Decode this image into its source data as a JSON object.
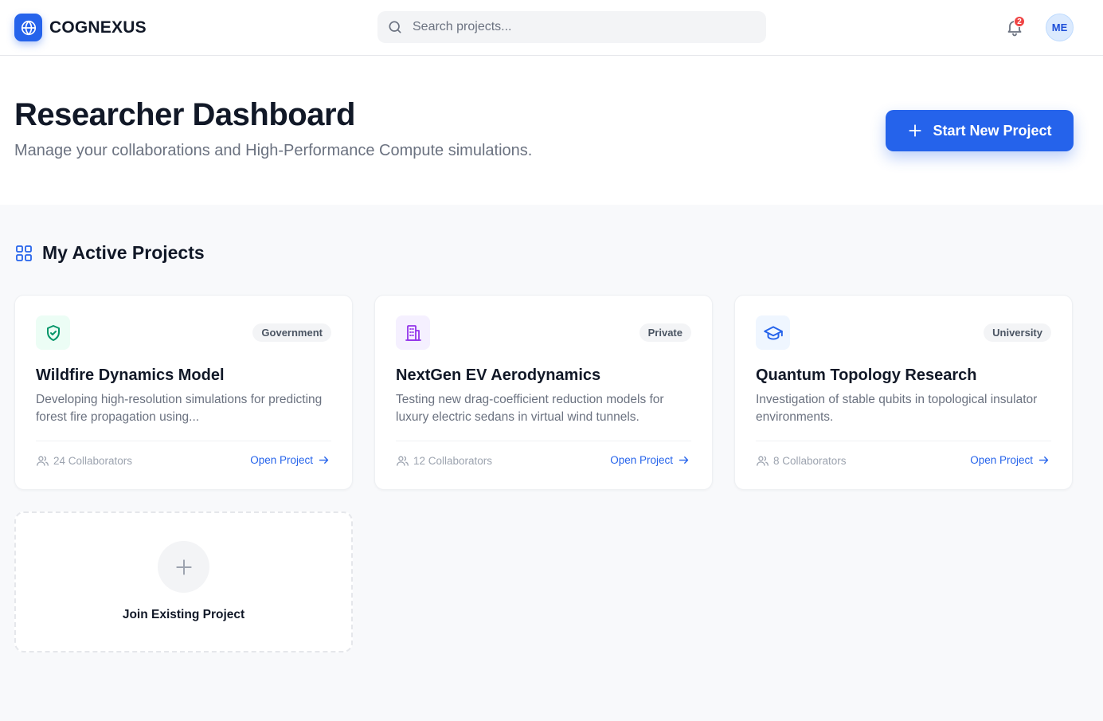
{
  "brand": {
    "name": "COGNEXUS",
    "icon": "globe-icon",
    "color": "#2563eb"
  },
  "search": {
    "placeholder": "Search projects...",
    "value": ""
  },
  "notifications": {
    "icon": "bell-icon",
    "count": "2"
  },
  "user": {
    "initials": "ME"
  },
  "hero": {
    "title": "Researcher Dashboard",
    "subtitle": "Manage your collaborations and High-Performance Compute simulations.",
    "start_button": "Start New Project"
  },
  "section": {
    "title": "My Active Projects",
    "icon": "grid-icon"
  },
  "projects": [
    {
      "icon": "shield-check-icon",
      "icon_color": "#059669",
      "icon_bg": "#ecfdf5",
      "badge": "Government",
      "title": "Wildfire Dynamics Model",
      "description": "Developing high-resolution simulations for predicting forest fire propagation using...",
      "collaborators": "24 Collaborators",
      "open_label": "Open Project"
    },
    {
      "icon": "building-icon",
      "icon_color": "#9333ea",
      "icon_bg": "#f5f0ff",
      "badge": "Private",
      "title": "NextGen EV Aerodynamics",
      "description": "Testing new drag-coefficient reduction models for luxury electric sedans in virtual wind tunnels.",
      "collaborators": "12 Collaborators",
      "open_label": "Open Project"
    },
    {
      "icon": "graduation-cap-icon",
      "icon_color": "#2563eb",
      "icon_bg": "#eff6ff",
      "badge": "University",
      "title": "Quantum Topology Research",
      "description": "Investigation of stable qubits in topological insulator environments.",
      "collaborators": "8 Collaborators",
      "open_label": "Open Project"
    }
  ],
  "join": {
    "label": "Join Existing Project",
    "icon": "plus-icon"
  }
}
